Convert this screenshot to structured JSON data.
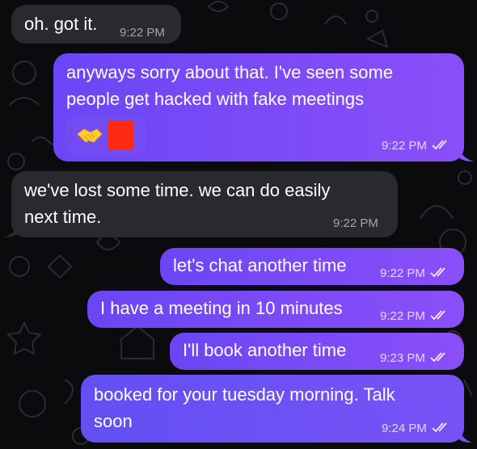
{
  "messages": [
    {
      "direction": "incoming",
      "text": "oh. got it.",
      "time": "9:22 PM"
    },
    {
      "direction": "outgoing",
      "lines": [
        "anyways sorry about that. I've seen some",
        "people get hacked with fake meetings"
      ],
      "emoji": [
        "handshake-emoji",
        "redacted-red-box"
      ],
      "time": "9:22 PM",
      "read": true
    },
    {
      "direction": "incoming",
      "lines": [
        "we've lost some time. we can do easily",
        "next time."
      ],
      "time": "9:22 PM"
    },
    {
      "direction": "outgoing",
      "text": "let's chat another time",
      "time": "9:22 PM",
      "read": true
    },
    {
      "direction": "outgoing",
      "text": "I have a meeting in 10 minutes",
      "time": "9:22 PM",
      "read": true
    },
    {
      "direction": "outgoing",
      "text": "I'll book another time",
      "time": "9:23 PM",
      "read": true
    },
    {
      "direction": "outgoing",
      "lines": [
        "booked for your tuesday morning. Talk",
        "soon"
      ],
      "time": "9:24 PM",
      "read": true
    }
  ],
  "colors": {
    "background": "#0b0b0d",
    "incoming_bubble": "#2a2a2e",
    "outgoing_bubble": "#7a4cf7",
    "text": "#ffffff"
  }
}
